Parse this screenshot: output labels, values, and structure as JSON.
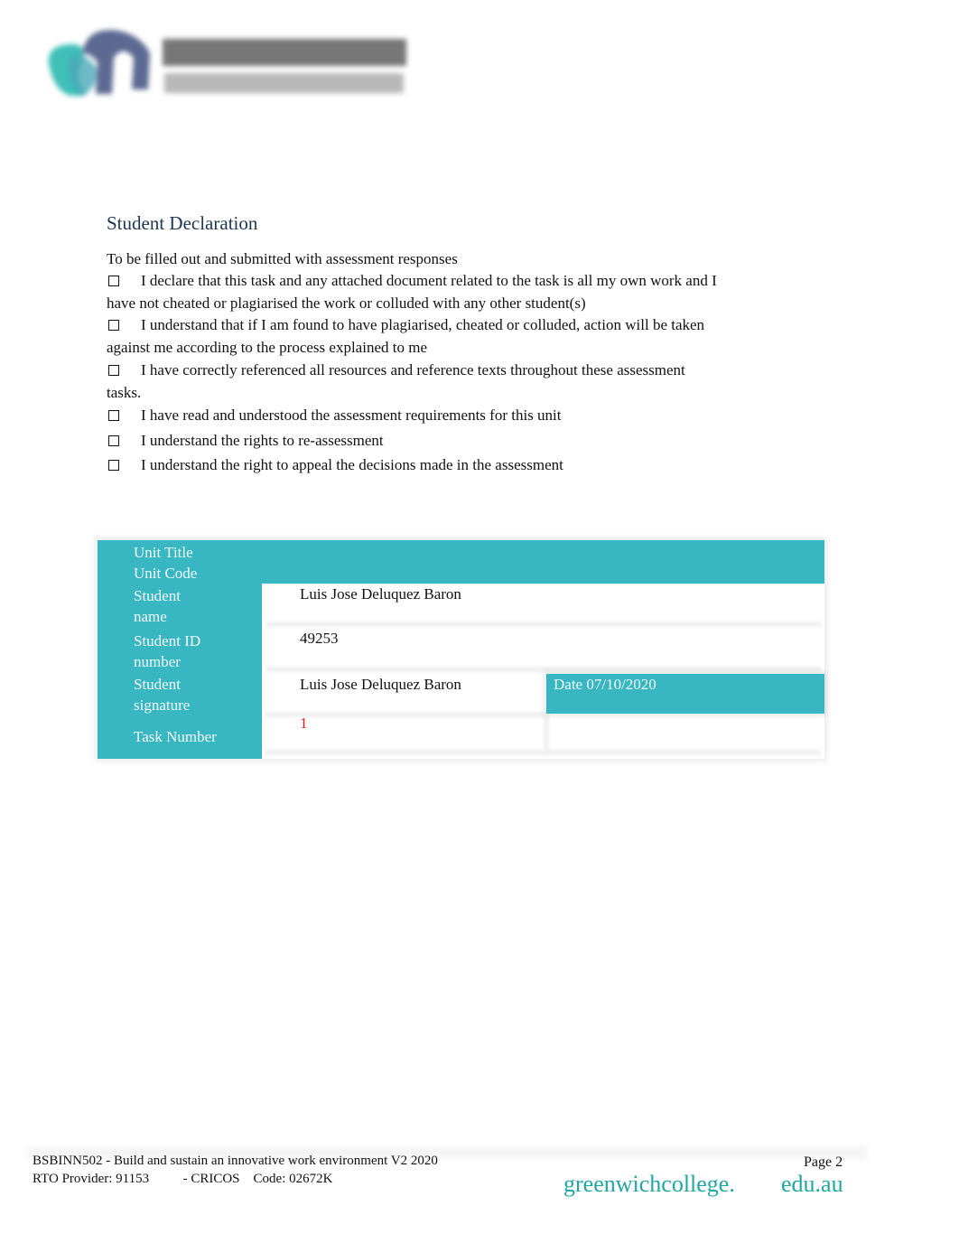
{
  "logo": {
    "name": "GREENWICH Management College",
    "colors": {
      "teal": "#3fbfb8",
      "navy": "#3f4f7f",
      "text": "#555555"
    }
  },
  "declaration": {
    "title": "Student Declaration",
    "intro": "To be filled out and submitted with assessment responses",
    "items": [
      {
        "icon": "checkbox-empty",
        "checked": false,
        "text": "I declare that this task and any attached document related to the task is all my own work and I have not cheated or plagiarised the work or colluded with any other student(s)"
      },
      {
        "icon": "checkbox-empty",
        "checked": false,
        "text": "I understand that if I am found to have plagiarised, cheated or colluded, action will be taken against me according to the process explained to me"
      },
      {
        "icon": "checkbox-empty",
        "checked": false,
        "text": "I have correctly referenced all resources and reference texts throughout these assessment tasks."
      },
      {
        "icon": "checkbox-empty",
        "checked": false,
        "text": "I have read and understood the assessment requirements for this unit"
      },
      {
        "icon": "checkbox-empty",
        "checked": false,
        "text": "I understand the rights to re-assessment"
      },
      {
        "icon": "checkbox-empty",
        "checked": false,
        "text": "I understand the right to appeal the decisions made in the assessment"
      }
    ]
  },
  "details_table": {
    "accent_color": "#38b6c2",
    "rows": [
      {
        "label": "Unit Title",
        "value": ""
      },
      {
        "label": "Unit Code",
        "value": ""
      },
      {
        "label": "Student name",
        "value": "Luis Jose Deluquez Baron"
      },
      {
        "label": "Student ID number",
        "value": "49253"
      },
      {
        "label": "Student signature",
        "value": "Luis Jose Deluquez Baron"
      },
      {
        "label": "Task Number",
        "value": "1"
      }
    ],
    "date_label": "Date 07/10/2020"
  },
  "footer": {
    "unit": "BSBINN502 - Build and sustain an innovative work environment V2 2020",
    "provider": "RTO Provider: 91153          - CRICOS    Code: 02672K",
    "page": "Page 2",
    "website_part1": "greenwichcollege.",
    "website_part2": "edu.au",
    "website_color": "#21a6a0"
  }
}
